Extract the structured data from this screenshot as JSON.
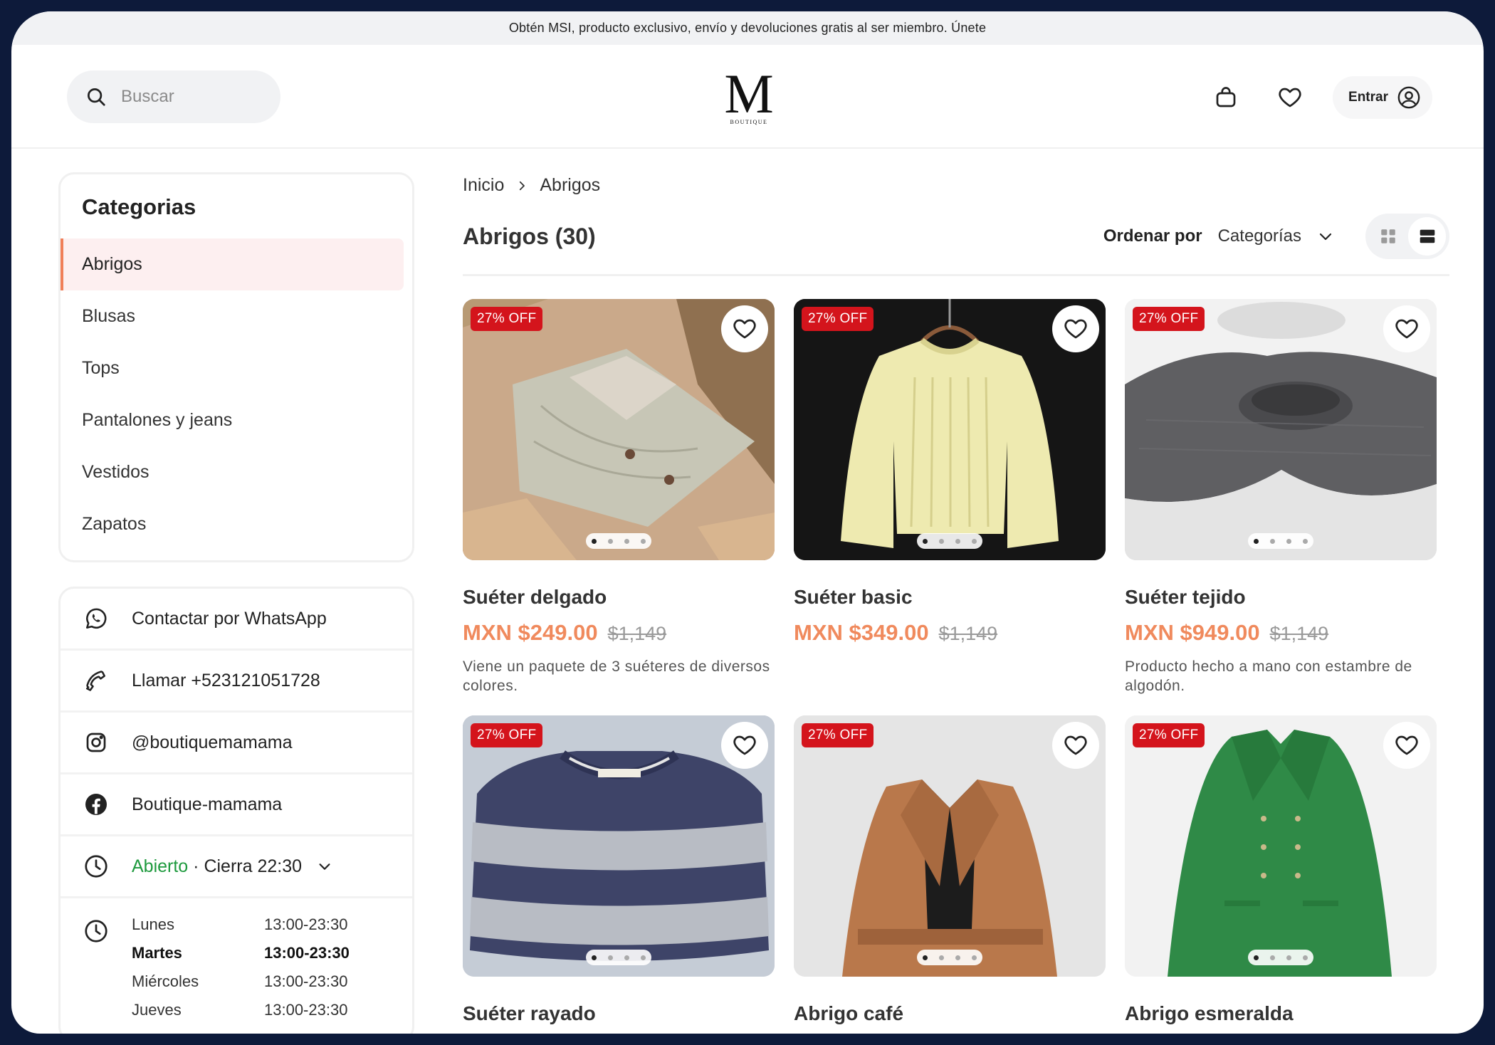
{
  "promo": {
    "text": "Obtén MSI, producto exclusivo, envío y devoluciones gratis al ser miembro. Únete"
  },
  "header": {
    "search_placeholder": "Buscar",
    "logo_mark": "M",
    "logo_sub": "BOUTIQUE",
    "login_label": "Entrar"
  },
  "sidebar": {
    "title": "Categorias",
    "items": [
      {
        "label": "Abrigos",
        "active": true
      },
      {
        "label": "Blusas"
      },
      {
        "label": "Tops"
      },
      {
        "label": "Pantalones y jeans"
      },
      {
        "label": "Vestidos"
      },
      {
        "label": "Zapatos"
      }
    ]
  },
  "contact": {
    "whatsapp": "Contactar por WhatsApp",
    "phone": "Llamar +523121051728",
    "instagram": "@boutiquemamama",
    "facebook": "Boutique-mamama",
    "status_open": "Abierto",
    "status_close": "· Cierra 22:30",
    "hours": [
      {
        "day": "Lunes",
        "time": "13:00-23:30"
      },
      {
        "day": "Martes",
        "time": "13:00-23:30"
      },
      {
        "day": "Miércoles",
        "time": "13:00-23:30"
      },
      {
        "day": "Jueves",
        "time": "13:00-23:30"
      }
    ]
  },
  "main": {
    "breadcrumb": [
      "Inicio",
      "Abrigos"
    ],
    "title": "Abrigos (30)",
    "sort_label": "Ordenar por",
    "sort_value": "Categorías"
  },
  "products": [
    {
      "name": "Suéter delgado",
      "badge": "27% OFF",
      "price": "MXN $249.00",
      "old_price": "$1,149",
      "desc": "Viene un paquete de 3 suéteres de diversos colores."
    },
    {
      "name": "Suéter basic",
      "badge": "27% OFF",
      "price": "MXN $349.00",
      "old_price": "$1,149",
      "desc": ""
    },
    {
      "name": "Suéter tejido",
      "badge": "27% OFF",
      "price": "MXN $949.00",
      "old_price": "$1,149",
      "desc": "Producto hecho a mano con estambre de algodón."
    },
    {
      "name": "Suéter rayado",
      "badge": "27% OFF"
    },
    {
      "name": "Abrigo café",
      "badge": "27% OFF"
    },
    {
      "name": "Abrigo esmeralda",
      "badge": "27% OFF"
    }
  ],
  "colors": {
    "accent_price": "#f08a5d",
    "badge_red": "#d4141c",
    "open_green": "#1e9a3e",
    "active_bg": "#fdeff0",
    "active_bar": "#f07f59"
  }
}
